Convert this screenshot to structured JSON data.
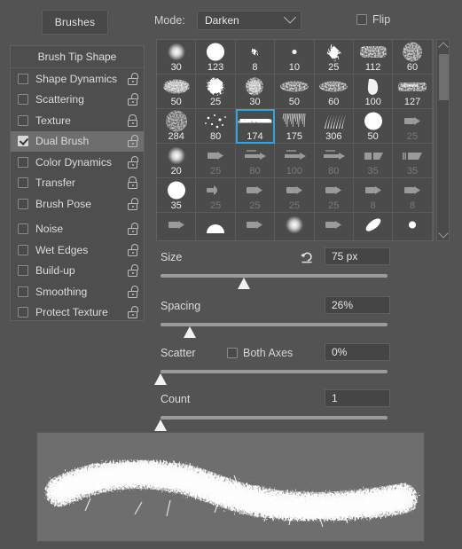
{
  "header": {
    "tab_label": "Brushes",
    "mode_label": "Mode:",
    "mode_value": "Darken",
    "flip_label": "Flip",
    "flip_checked": false
  },
  "sidebar": {
    "title": "Brush Tip Shape",
    "items": [
      {
        "label": "Shape Dynamics",
        "checked": false,
        "locked": false
      },
      {
        "label": "Scattering",
        "checked": false,
        "locked": false
      },
      {
        "label": "Texture",
        "checked": false,
        "locked": true
      },
      {
        "label": "Dual Brush",
        "checked": true,
        "locked": false
      },
      {
        "label": "Color Dynamics",
        "checked": false,
        "locked": false
      },
      {
        "label": "Transfer",
        "checked": false,
        "locked": true
      },
      {
        "label": "Brush Pose",
        "checked": false,
        "locked": false
      },
      {
        "label": "Noise",
        "checked": false,
        "locked": false
      },
      {
        "label": "Wet Edges",
        "checked": false,
        "locked": false
      },
      {
        "label": "Build-up",
        "checked": false,
        "locked": false
      },
      {
        "label": "Smoothing",
        "checked": false,
        "locked": false
      },
      {
        "label": "Protect Texture",
        "checked": false,
        "locked": false
      }
    ]
  },
  "brush_grid": {
    "selected_index": 16,
    "selection_color": "#2aa8e0",
    "cells": [
      {
        "size": "30",
        "shape": "soft-round",
        "dim": false
      },
      {
        "size": "123",
        "shape": "hard-round",
        "dim": false
      },
      {
        "size": "8",
        "shape": "tiny-splat",
        "dim": false
      },
      {
        "size": "10",
        "shape": "tiny-dot",
        "dim": false
      },
      {
        "size": "25",
        "shape": "spatter",
        "dim": false
      },
      {
        "size": "112",
        "shape": "grunge-smear",
        "dim": false
      },
      {
        "size": "60",
        "shape": "dense-speckle",
        "dim": false
      },
      {
        "size": "50",
        "shape": "oval-speckle",
        "dim": false
      },
      {
        "size": "25",
        "shape": "blob",
        "dim": false
      },
      {
        "size": "30",
        "shape": "cloud-speckle",
        "dim": false
      },
      {
        "size": "50",
        "shape": "scatter-chalk",
        "dim": false
      },
      {
        "size": "60",
        "shape": "scatter-chalk",
        "dim": false
      },
      {
        "size": "100",
        "shape": "thumb-stroke",
        "dim": false
      },
      {
        "size": "127",
        "shape": "flat-grunge",
        "dim": false
      },
      {
        "size": "284",
        "shape": "spray-dots",
        "dim": false
      },
      {
        "size": "80",
        "shape": "sparse-dots",
        "dim": false
      },
      {
        "size": "174",
        "shape": "dry-brush",
        "dim": false
      },
      {
        "size": "175",
        "shape": "bristle-fade",
        "dim": false
      },
      {
        "size": "306",
        "shape": "grass-tuft",
        "dim": false
      },
      {
        "size": "50",
        "shape": "hard-round",
        "dim": false
      },
      {
        "size": "25",
        "shape": "pencil-tip",
        "dim": true
      },
      {
        "size": "20",
        "shape": "soft-round",
        "dim": false
      },
      {
        "size": "25",
        "shape": "pencil-tip",
        "dim": true
      },
      {
        "size": "80",
        "shape": "pencil-long",
        "dim": true
      },
      {
        "size": "100",
        "shape": "pencil-long",
        "dim": true
      },
      {
        "size": "80",
        "shape": "pencil-long",
        "dim": true
      },
      {
        "size": "35",
        "shape": "eraser",
        "dim": true
      },
      {
        "size": "35",
        "shape": "eraser-angled",
        "dim": true
      },
      {
        "size": "35",
        "shape": "hard-round",
        "dim": false
      },
      {
        "size": "25",
        "shape": "airbrush-tip",
        "dim": true
      },
      {
        "size": "25",
        "shape": "pencil-tip",
        "dim": true
      },
      {
        "size": "25",
        "shape": "pencil-tip",
        "dim": true
      },
      {
        "size": "25",
        "shape": "pencil-tip",
        "dim": true
      },
      {
        "size": "8",
        "shape": "pencil-tip",
        "dim": true
      },
      {
        "size": "8",
        "shape": "pencil-tip",
        "dim": true
      },
      {
        "size": "",
        "shape": "pencil-tip",
        "dim": true
      },
      {
        "size": "",
        "shape": "dome",
        "dim": false
      },
      {
        "size": "",
        "shape": "pencil-tip",
        "dim": true
      },
      {
        "size": "",
        "shape": "soft-round",
        "dim": false
      },
      {
        "size": "",
        "shape": "pencil-tip",
        "dim": true
      },
      {
        "size": "",
        "shape": "ellipse-tilt",
        "dim": false
      },
      {
        "size": "",
        "shape": "small-dot",
        "dim": false
      }
    ]
  },
  "scrollbar": {
    "up_icon": "chevron-up-icon",
    "down_icon": "chevron-down-icon"
  },
  "controls": {
    "size": {
      "label": "Size",
      "value": "75 px",
      "reset_icon": "revert-arrow-icon",
      "handle_percent": 37
    },
    "spacing": {
      "label": "Spacing",
      "value": "26%",
      "handle_percent": 13
    },
    "scatter": {
      "label": "Scatter",
      "value": "0%",
      "both_axes_label": "Both Axes",
      "both_axes_checked": false,
      "handle_percent": 0
    },
    "count": {
      "label": "Count",
      "value": "1",
      "handle_percent": 0
    }
  },
  "preview": {
    "stroke_name": "dual-brush-stroke-preview"
  }
}
